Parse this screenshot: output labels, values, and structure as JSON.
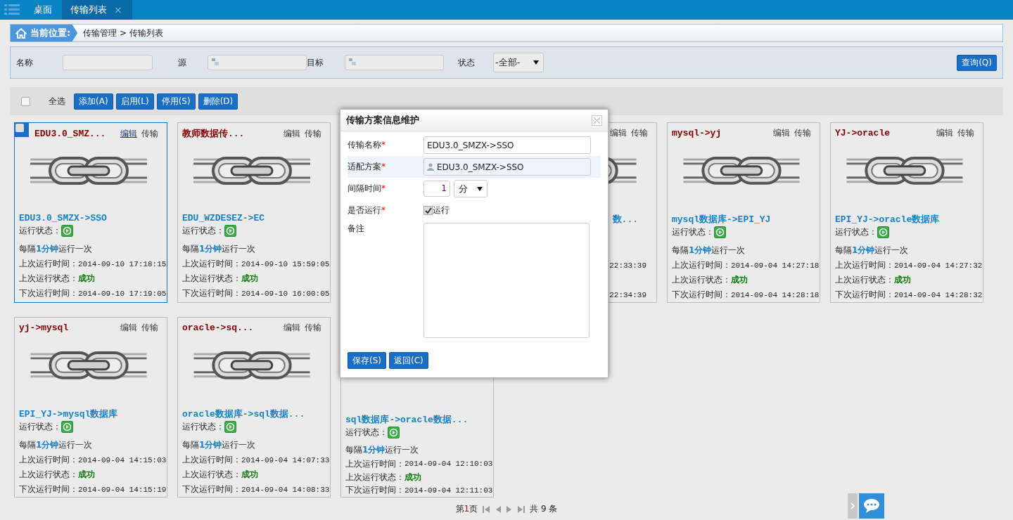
{
  "tabs": [
    {
      "label": "桌面",
      "selected": false,
      "closable": false
    },
    {
      "label": "传输列表",
      "selected": true,
      "closable": true,
      "close": "×"
    }
  ],
  "breadcrumb": {
    "label": "当前位置:",
    "path": "传输管理 > 传输列表"
  },
  "filters": {
    "name_label": "名称",
    "source_label": "源",
    "target_label": "目标",
    "status_label": "状态",
    "status_value": "-全部-",
    "query": "查询(Q)"
  },
  "toolbar": {
    "select_all": {
      "label": "全选",
      "checked": false
    },
    "buttons": [
      "添加(A)",
      "启用(L)",
      "停用(S)",
      "删除(D)"
    ]
  },
  "card_rows": [
    [
      {
        "kind": "full",
        "selected": true,
        "title": "EDU3.0_SMZ...",
        "actions": [
          {
            "label": "编辑",
            "hovered": true
          },
          {
            "label": "传输",
            "hovered": false
          }
        ],
        "name": "EDU3.0_SMZX->SSO",
        "status_label": "运行状态：",
        "interval": [
          "每隔",
          "1分钟",
          "运行一次"
        ],
        "last_run": {
          "label": "上次运行时间：",
          "value": "2014-09-10 17:18:15"
        },
        "last_status": {
          "label": "上次运行状态：",
          "value": "成功"
        },
        "next_run": {
          "label": "下次运行时间：",
          "value": "2014-09-10 17:19:05"
        }
      },
      {
        "kind": "full",
        "selected": false,
        "title": "教师数据传...",
        "actions": [
          {
            "label": "编辑",
            "hovered": false
          },
          {
            "label": "传输",
            "hovered": false
          }
        ],
        "name": "EDU_WZDESEZ->EC",
        "status_label": "运行状态：",
        "interval": [
          "每隔",
          "1分钟",
          "运行一次"
        ],
        "last_run": {
          "label": "上次运行时间：",
          "value": "2014-09-10 15:59:05"
        },
        "last_status": {
          "label": "上次运行状态：",
          "value": "成功"
        },
        "next_run": {
          "label": "下次运行时间：",
          "value": "2014-09-10 16:00:05"
        }
      },
      {
        "kind": "right",
        "selected": false,
        "actions": [
          {
            "label": "编辑",
            "hovered": false
          },
          {
            "label": "传输",
            "hovered": false
          }
        ],
        "name": "数...",
        "last_run": {
          "value": "22:33:39"
        },
        "next_run": {
          "value": "22:34:39"
        }
      },
      {
        "kind": "full",
        "selected": false,
        "title": "mysql->yj",
        "actions": [
          {
            "label": "编辑",
            "hovered": false
          },
          {
            "label": "传输",
            "hovered": false
          }
        ],
        "name": "mysql数据库->EPI_YJ",
        "status_label": "运行状态：",
        "interval": [
          "每隔",
          "1分钟",
          "运行一次"
        ],
        "last_run": {
          "label": "上次运行时间：",
          "value": "2014-09-04 14:27:18"
        },
        "last_status": {
          "label": "上次运行状态：",
          "value": "成功"
        },
        "next_run": {
          "label": "下次运行时间：",
          "value": "2014-09-04 14:28:18"
        }
      },
      {
        "kind": "full",
        "selected": false,
        "title": "YJ->oracle",
        "actions": [
          {
            "label": "编辑",
            "hovered": false
          },
          {
            "label": "传输",
            "hovered": false
          }
        ],
        "name": "EPI_YJ->oracle数据库",
        "status_label": "运行状态：",
        "interval": [
          "每隔",
          "1分钟",
          "运行一次"
        ],
        "last_run": {
          "label": "上次运行时间：",
          "value": "2014-09-04 14:27:32"
        },
        "last_status": {
          "label": "上次运行状态：",
          "value": "成功"
        },
        "next_run": {
          "label": "下次运行时间：",
          "value": "2014-09-04 14:28:32"
        }
      }
    ],
    [
      {
        "kind": "full",
        "selected": false,
        "title": "yj->mysql",
        "actions": [
          {
            "label": "编辑",
            "hovered": false
          },
          {
            "label": "传输",
            "hovered": false
          }
        ],
        "name": "EPI_YJ->mysql数据库",
        "status_label": "运行状态：",
        "interval": [
          "每隔",
          "1分钟",
          "运行一次"
        ],
        "last_run": {
          "label": "上次运行时间：",
          "value": "2014-09-04 14:15:03"
        },
        "last_status": {
          "label": "上次运行状态：",
          "value": "成功"
        },
        "next_run": {
          "label": "下次运行时间：",
          "value": "2014-09-04 14:15:19"
        }
      },
      {
        "kind": "full",
        "selected": false,
        "title": "oracle->sq...",
        "actions": [
          {
            "label": "编辑",
            "hovered": false
          },
          {
            "label": "传输",
            "hovered": false
          }
        ],
        "name": "oracle数据库->sql数据...",
        "status_label": "运行状态：",
        "interval": [
          "每隔",
          "1分钟",
          "运行一次"
        ],
        "last_run": {
          "label": "上次运行时间：",
          "value": "2014-09-04 14:07:33"
        },
        "last_status": {
          "label": "上次运行状态：",
          "value": "成功"
        },
        "next_run": {
          "label": "下次运行时间：",
          "value": "2014-09-04 14:08:33"
        }
      },
      {
        "kind": "lower",
        "selected": false,
        "name": "sql数据库->oracle数据...",
        "status_label": "运行状态：",
        "interval": [
          "每隔",
          "1分钟",
          "运行一次"
        ],
        "last_run": {
          "label": "上次运行时间：",
          "value": "2014-09-04 12:10:03"
        },
        "last_status": {
          "label": "上次运行状态：",
          "value": "成功"
        },
        "next_run": {
          "label": "下次运行时间：",
          "value": "2014-09-04 12:11:03"
        }
      }
    ]
  ],
  "pager": {
    "prefix": "第",
    "page": "1",
    "suffix": "页",
    "total": "共 9 条"
  },
  "dialog": {
    "title": "传输方案信息维护",
    "required_mark": "*",
    "fields": [
      {
        "kind": "text",
        "label": "传输名称",
        "required": true,
        "value": "EDU3.0_SMZX->SSO"
      },
      {
        "kind": "picker",
        "label": "适配方案",
        "required": true,
        "value": "EDU3.0_SMZX->SSO"
      },
      {
        "kind": "interval",
        "label": "间隔时间",
        "required": true,
        "value": "1",
        "unit": "分"
      },
      {
        "kind": "checkbox",
        "label": "是否运行",
        "required": true,
        "checked": true,
        "option": "运行"
      },
      {
        "kind": "textarea",
        "label": "备注",
        "required": false
      }
    ],
    "buttons": [
      "保存(S)",
      "返回(C)"
    ]
  }
}
